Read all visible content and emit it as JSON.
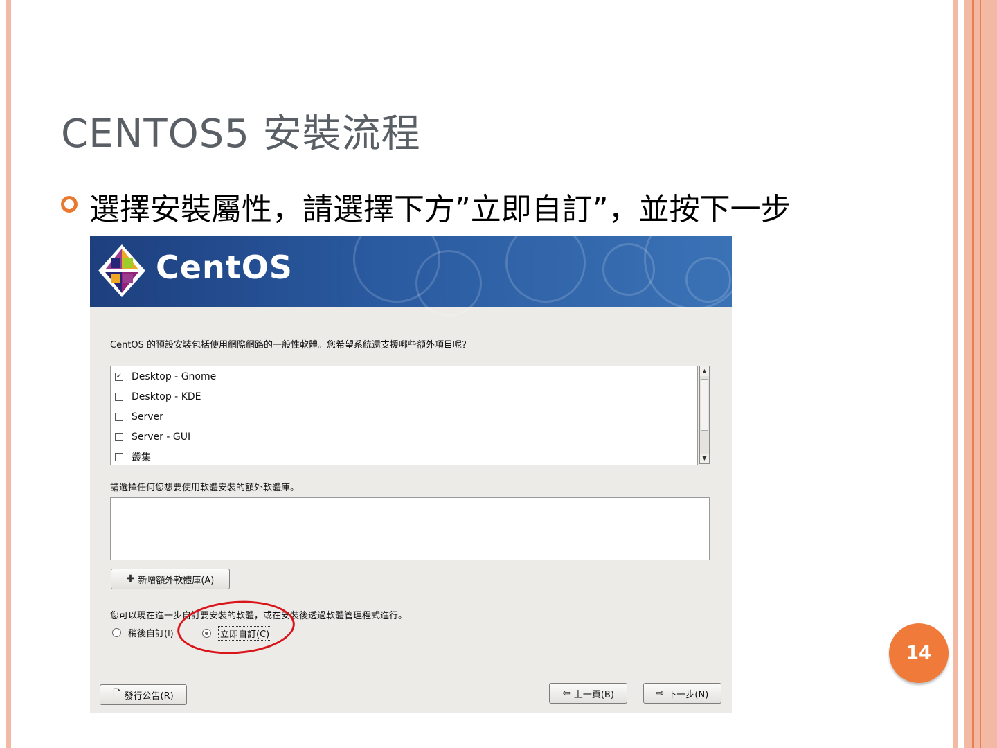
{
  "slide": {
    "title": "CENTOS5 安裝流程",
    "bullet": "選擇安裝屬性，請選擇下方”立即自訂”，並按下一步",
    "page_number": "14"
  },
  "installer": {
    "logo_text": "CentOS",
    "prompt": "CentOS 的預設安裝包括使用網際網路的一般性軟體。您希望系統還支援哪些額外項目呢？",
    "task_options": [
      {
        "label": "Desktop - Gnome",
        "checked": true
      },
      {
        "label": "Desktop - KDE",
        "checked": false
      },
      {
        "label": "Server",
        "checked": false
      },
      {
        "label": "Server - GUI",
        "checked": false
      },
      {
        "label": "叢集",
        "checked": false
      }
    ],
    "repo_label": "請選擇任何您想要使用軟體安裝的額外軟體庫。",
    "add_repo_button": "新增額外軟體庫(A)",
    "customize_label": "您可以現在進一步自訂要安裝的軟體，或在安裝後透過軟體管理程式進行。",
    "customize_later": "稍後自訂(l)",
    "customize_now": "立即自訂(C)",
    "selected_option": "customize_now",
    "release_notes_button": "發行公告(R)",
    "back_button": "上一頁(B)",
    "next_button": "下一步(N)"
  },
  "icons": {
    "bullet": "ring-bullet-icon",
    "add_repo": "plus-icon",
    "release_notes": "document-icon",
    "back": "arrow-left-icon",
    "next": "arrow-right-icon"
  },
  "colors": {
    "accent_orange": "#e8792f",
    "header_blue": "#2a5aa0",
    "annotation_red": "#d9141b",
    "slide_border": "#f3b9a4"
  }
}
